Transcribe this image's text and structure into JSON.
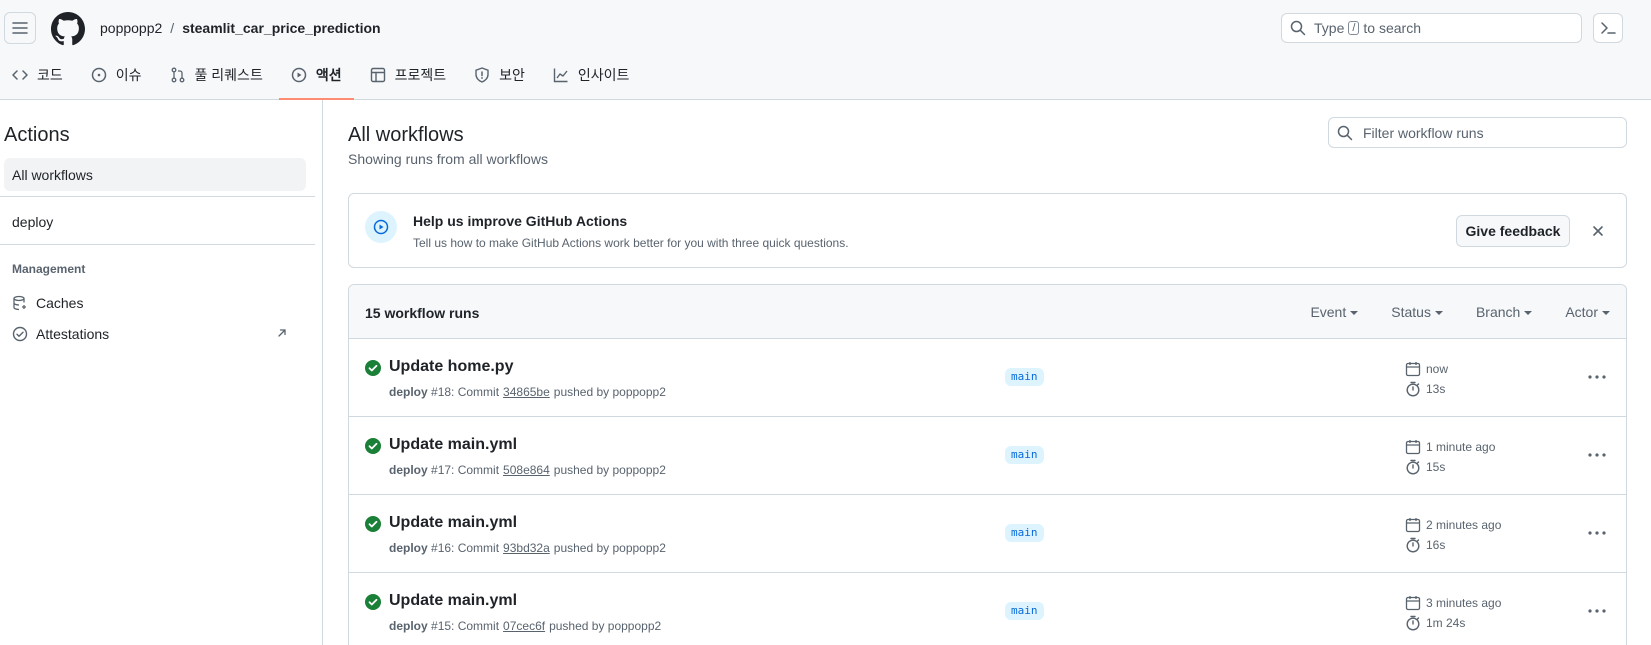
{
  "header": {
    "owner": "poppopp2",
    "separator": "/",
    "repo": "steamlit_car_price_prediction",
    "search_prefix": "Type",
    "search_key": "/",
    "search_suffix": "to search"
  },
  "tabs": [
    {
      "label": "코드",
      "icon": "code-icon"
    },
    {
      "label": "이슈",
      "icon": "issue-opened-icon"
    },
    {
      "label": "풀 리퀘스트",
      "icon": "git-pull-request-icon"
    },
    {
      "label": "액션",
      "icon": "play-icon",
      "active": true
    },
    {
      "label": "프로젝트",
      "icon": "table-icon"
    },
    {
      "label": "보안",
      "icon": "shield-icon"
    },
    {
      "label": "인사이트",
      "icon": "graph-icon"
    }
  ],
  "sidebar": {
    "title": "Actions",
    "all_workflows": "All workflows",
    "deploy": "deploy",
    "management_label": "Management",
    "caches": "Caches",
    "attestations": "Attestations"
  },
  "main": {
    "title": "All workflows",
    "subtitle": "Showing runs from all workflows",
    "filter_placeholder": "Filter workflow runs"
  },
  "banner": {
    "title": "Help us improve GitHub Actions",
    "description": "Tell us how to make GitHub Actions work better for you with three quick questions.",
    "feedback_label": "Give feedback"
  },
  "runs": {
    "count_label": "15 workflow runs",
    "filters": [
      "Event",
      "Status",
      "Branch",
      "Actor"
    ],
    "items": [
      {
        "title": "Update home.py",
        "workflow": "deploy",
        "number": "#18: Commit",
        "sha": "34865be",
        "pushed_by": "pushed by poppopp2",
        "branch": "main",
        "when": "now",
        "duration": "13s"
      },
      {
        "title": "Update main.yml",
        "workflow": "deploy",
        "number": "#17: Commit",
        "sha": "508e864",
        "pushed_by": "pushed by poppopp2",
        "branch": "main",
        "when": "1 minute ago",
        "duration": "15s"
      },
      {
        "title": "Update main.yml",
        "workflow": "deploy",
        "number": "#16: Commit",
        "sha": "93bd32a",
        "pushed_by": "pushed by poppopp2",
        "branch": "main",
        "when": "2 minutes ago",
        "duration": "16s"
      },
      {
        "title": "Update main.yml",
        "workflow": "deploy",
        "number": "#15: Commit",
        "sha": "07cec6f",
        "pushed_by": "pushed by poppopp2",
        "branch": "main",
        "when": "3 minutes ago",
        "duration": "1m 24s"
      }
    ]
  },
  "colors": {
    "success": "#1a7f37",
    "accent": "#0969da",
    "active_tab_underline": "#fd8c73"
  }
}
